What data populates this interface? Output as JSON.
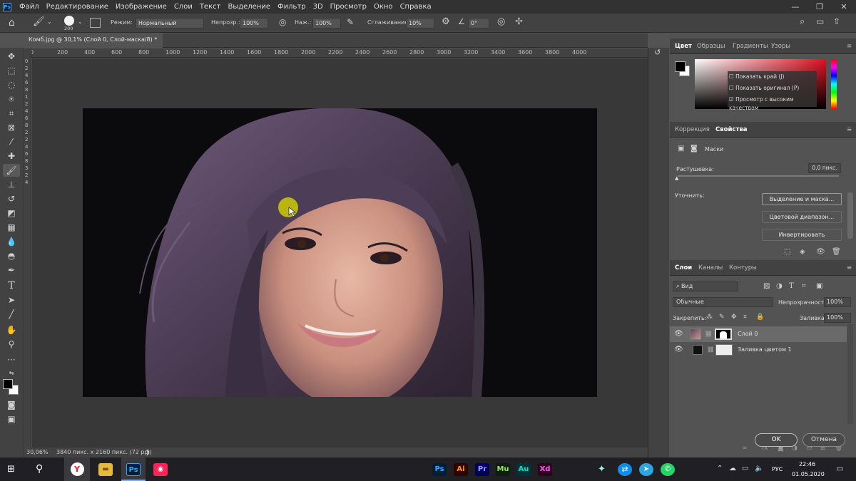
{
  "menubar": {
    "logo": "Ps",
    "items": [
      "Файл",
      "Редактирование",
      "Изображение",
      "Слои",
      "Текст",
      "Выделение",
      "Фильтр",
      "3D",
      "Просмотр",
      "Окно",
      "Справка"
    ],
    "window_buttons": [
      "—",
      "❐",
      "✕"
    ]
  },
  "options": {
    "brush_size": "200",
    "mode_label": "Режим:",
    "mode_value": "Нормальный",
    "opacity_label": "Непрозр.:",
    "opacity_value": "100%",
    "pressure_label": "Наж.:",
    "pressure_value": "100%",
    "smoothing_label": "Сглаживание:",
    "smoothing_value": "10%",
    "angle_value": "0°"
  },
  "document": {
    "tab_title": "Комб.jpg @ 30,1% (Слой 0, Слой-маска/8) *",
    "ruler_h": [
      "0",
      "200",
      "400",
      "600",
      "800",
      "1000",
      "1200",
      "1400",
      "1600",
      "1800",
      "2000",
      "2200",
      "2400",
      "2600",
      "2800",
      "3000",
      "3200",
      "3400",
      "3600",
      "3800",
      "4000"
    ],
    "ruler_v": [
      "0",
      "2",
      "4",
      "6",
      "8",
      "1",
      "2",
      "4",
      "6",
      "8",
      "2",
      "2",
      "4",
      "6",
      "8",
      "3",
      "2",
      "4"
    ]
  },
  "status": {
    "zoom": "30,06%",
    "doc_info": "3840 пикс. x 2160 пикс. (72 ppi)",
    "arrow": "❯"
  },
  "color_panel": {
    "tabs": [
      "Цвет",
      "Образцы",
      "Градиенты",
      "Узоры"
    ],
    "overlay": [
      "Показать край (J)",
      "Показать оригинал (P)",
      "Просмотр с высоким качеством"
    ]
  },
  "properties_panel": {
    "tabs": [
      "Коррекция",
      "Свойства"
    ],
    "mask_label": "Маски",
    "feather_label": "Растушевка:",
    "feather_value": "0,0 пикс.",
    "refine_label": "Уточнить:",
    "buttons": [
      "Выделение и маска...",
      "Цветовой диапазон...",
      "Инвертировать"
    ]
  },
  "layers_panel": {
    "tabs": [
      "Слои",
      "Каналы",
      "Контуры"
    ],
    "filter_value": "Вид",
    "blend_mode": "Обычные",
    "opacity_label": "Непрозрачность:",
    "opacity_value": "100%",
    "lock_label": "Закрепить:",
    "fill_label": "Заливка:",
    "fill_value": "100%",
    "layers": [
      {
        "name": "Слой 0"
      },
      {
        "name": "Заливка цветом 1"
      }
    ]
  },
  "dialog": {
    "ok": "OK",
    "cancel": "Отмена"
  },
  "taskbar": {
    "apps": [
      "Ps",
      "Ai",
      "Pr",
      "Mu",
      "Au",
      "Xd"
    ],
    "lang": "РУС",
    "time": "22:46",
    "date": "01.05.2020"
  },
  "colors": {
    "accent": "#31a8ff",
    "cursor_highlight": "#d4d400"
  }
}
